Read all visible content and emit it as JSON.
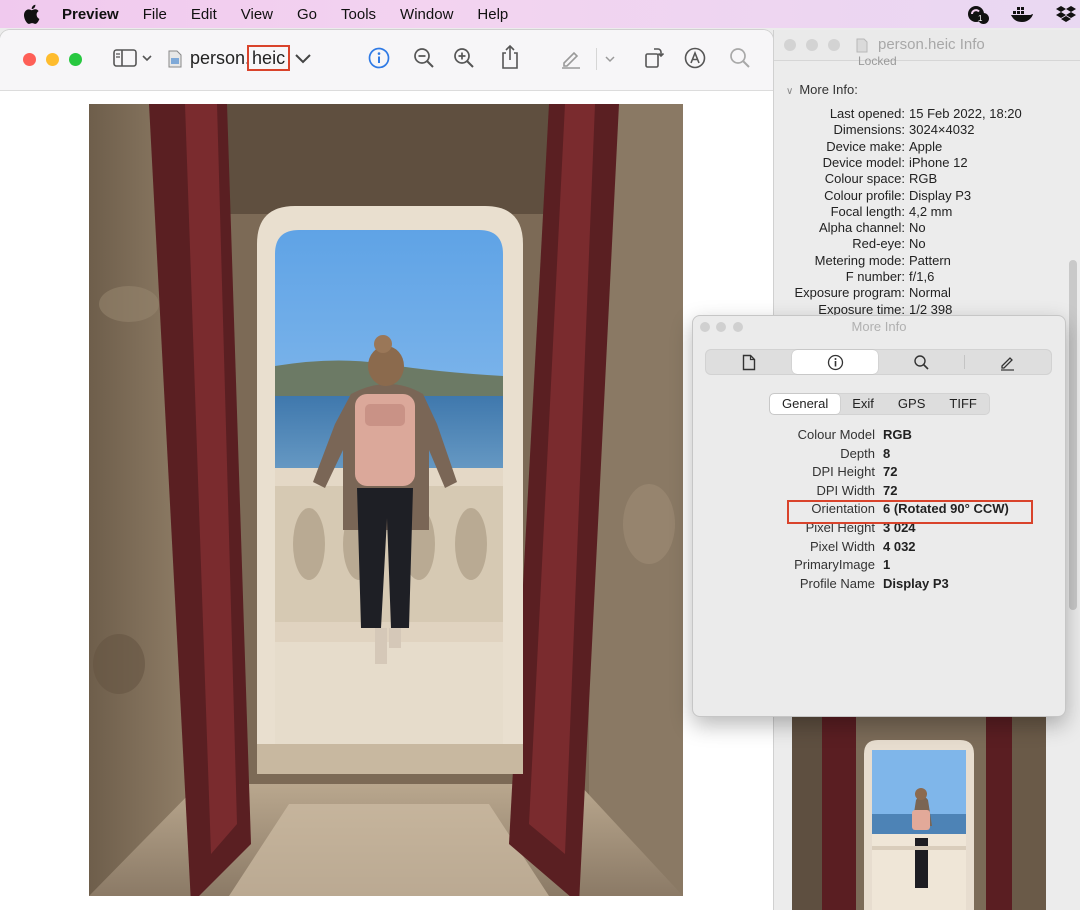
{
  "menubar": {
    "app": "Preview",
    "items": [
      "File",
      "Edit",
      "View",
      "Go",
      "Tools",
      "Window",
      "Help"
    ],
    "status_badge": "1"
  },
  "main_window": {
    "filename_base": "person.",
    "filename_ext": "heic"
  },
  "info_window": {
    "title": "person.heic Info",
    "locked_label": "Locked",
    "section_header": "More Info:",
    "rows": [
      {
        "k": "Last opened:",
        "v": "15 Feb 2022, 18:20"
      },
      {
        "k": "Dimensions:",
        "v": "3024×4032"
      },
      {
        "k": "Device make:",
        "v": "Apple"
      },
      {
        "k": "Device model:",
        "v": "iPhone 12"
      },
      {
        "k": "Colour space:",
        "v": "RGB"
      },
      {
        "k": "Colour profile:",
        "v": "Display P3"
      },
      {
        "k": "Focal length:",
        "v": "4,2 mm"
      },
      {
        "k": "Alpha channel:",
        "v": "No"
      },
      {
        "k": "Red-eye:",
        "v": "No"
      },
      {
        "k": "Metering mode:",
        "v": "Pattern"
      },
      {
        "k": "F number:",
        "v": "f/1,6"
      },
      {
        "k": "Exposure program:",
        "v": "Normal"
      },
      {
        "k": "Exposure time:",
        "v": "1/2 398"
      }
    ]
  },
  "more_info_panel": {
    "title": "More Info",
    "tabs": [
      "General",
      "Exif",
      "GPS",
      "TIFF"
    ],
    "selected_tab": "General",
    "rows": [
      {
        "k": "Colour Model",
        "v": "RGB"
      },
      {
        "k": "Depth",
        "v": "8"
      },
      {
        "k": "DPI Height",
        "v": "72"
      },
      {
        "k": "DPI Width",
        "v": "72"
      },
      {
        "k": "Orientation",
        "v": "6 (Rotated 90° CCW)"
      },
      {
        "k": "Pixel Height",
        "v": "3 024"
      },
      {
        "k": "Pixel Width",
        "v": "4 032"
      },
      {
        "k": "PrimaryImage",
        "v": "1"
      },
      {
        "k": "Profile Name",
        "v": "Display P3"
      }
    ]
  },
  "colors": {
    "highlight": "#d9432b",
    "accent": "#2f7ae5",
    "close": "#fe5f57",
    "minimize": "#febc2e",
    "zoom": "#28c840"
  }
}
